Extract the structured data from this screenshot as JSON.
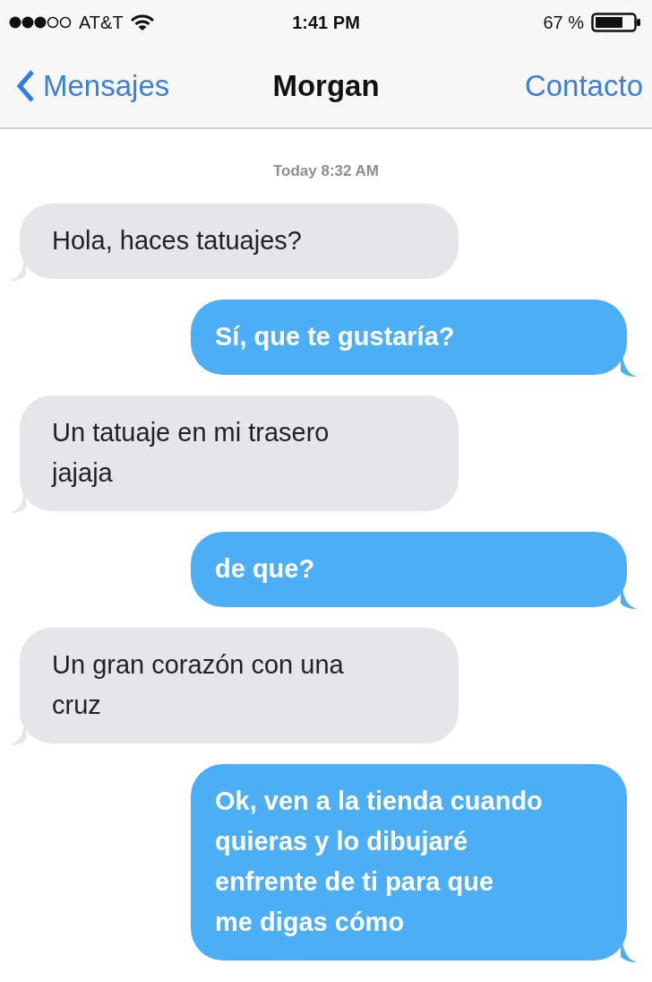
{
  "status_bar": {
    "carrier": "AT&T",
    "time": "1:41 PM",
    "battery": "67 %"
  },
  "nav": {
    "back": "Mensajes",
    "title": "Morgan",
    "action": "Contacto"
  },
  "timestamp": "Today 8:32 AM",
  "messages": [
    {
      "kind": "received",
      "text": "Hola, haces tatuajes?"
    },
    {
      "kind": "sent",
      "text": "Sí, que te gustaría?"
    },
    {
      "kind": "received",
      "text": "Un tatuaje en mi trasero\njajaja"
    },
    {
      "kind": "sent",
      "text": "de que?"
    },
    {
      "kind": "received",
      "text": "Un gran corazón con una\ncruz"
    },
    {
      "kind": "sent",
      "text": "Ok, ven a la tienda cuando\nquieras y lo dibujaré\nenfrente de ti para que\nme digas cómo"
    }
  ]
}
